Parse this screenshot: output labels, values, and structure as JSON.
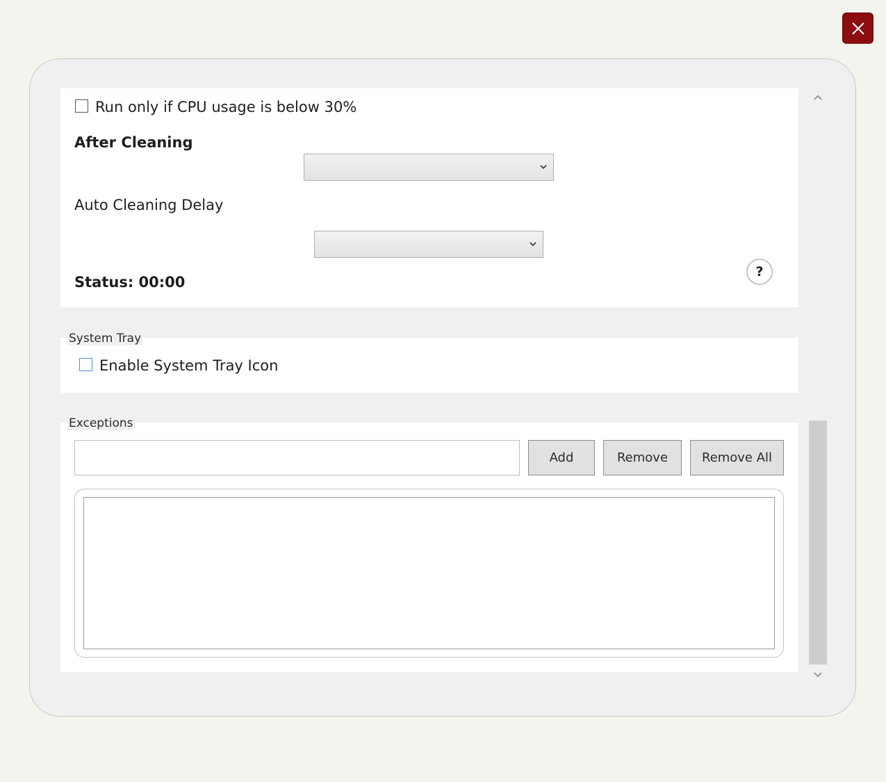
{
  "window": {
    "close_icon": "close-icon"
  },
  "scheduling": {
    "cpu_checkbox_label": "Run only if CPU usage is below 30%",
    "cpu_checked": false,
    "after_cleaning_heading": "After Cleaning",
    "after_cleaning_value": "",
    "auto_delay_label": "Auto Cleaning Delay",
    "auto_delay_value": "",
    "status_text": "Status: 00:00",
    "help_glyph": "?"
  },
  "system_tray": {
    "caption": "System Tray",
    "enable_label": "Enable System Tray Icon",
    "enable_checked": false
  },
  "exceptions": {
    "caption": "Exceptions",
    "input_value": "",
    "add_label": "Add",
    "remove_label": "Remove",
    "remove_all_label": "Remove All",
    "items": []
  },
  "colors": {
    "close_button": "#8b0d10",
    "page_background": "#f4f4ef",
    "dialog_background": "#f0f0f0",
    "panel_background": "#ffffff",
    "scroll_thumb": "#cdcdcd"
  }
}
